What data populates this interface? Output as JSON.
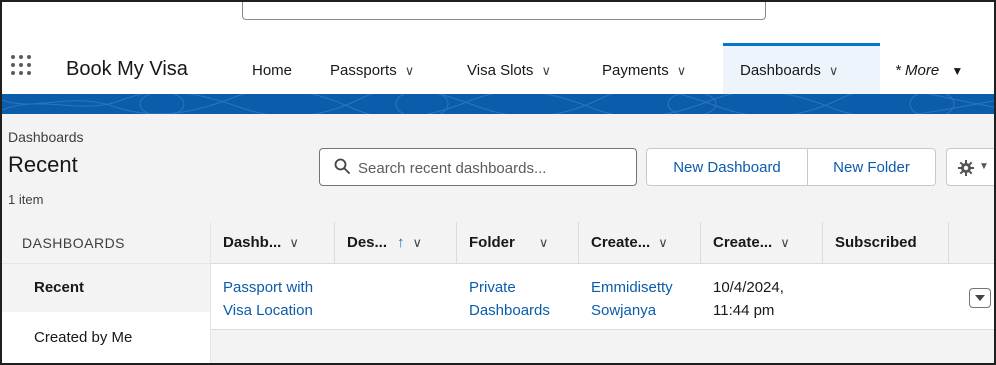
{
  "app": {
    "name": "Book My Visa"
  },
  "nav": {
    "items": [
      {
        "label": "Home"
      },
      {
        "label": "Passports"
      },
      {
        "label": "Visa Slots"
      },
      {
        "label": "Payments"
      },
      {
        "label": "Dashboards",
        "active": true
      }
    ],
    "more_star": "*",
    "more_label": "More"
  },
  "header": {
    "breadcrumb": "Dashboards",
    "title": "Recent",
    "count": "1 item"
  },
  "search": {
    "placeholder": "Search recent dashboards..."
  },
  "buttons": {
    "new_dashboard": "New Dashboard",
    "new_folder": "New Folder"
  },
  "sidebar": {
    "heading": "DASHBOARDS",
    "items": [
      {
        "label": "Recent",
        "active": true
      },
      {
        "label": "Created by Me"
      }
    ]
  },
  "table": {
    "columns": [
      "Dashb...",
      "Des...",
      "Folder",
      "Create...",
      "Create...",
      "Subscribed"
    ],
    "rows": [
      {
        "name_line1": "Passport with",
        "name_line2": "Visa Location",
        "description": "",
        "folder_line1": "Private",
        "folder_line2": "Dashboards",
        "created_by_line1": "Emmidisetty",
        "created_by_line2": "Sowjanya",
        "created_on_line1": "10/4/2024,",
        "created_on_line2": "11:44 pm",
        "subscribed": ""
      }
    ]
  },
  "colors": {
    "brand_band": "#0b5cab",
    "link": "#0b5cab",
    "active_tab_border": "#0176d3"
  },
  "icons": [
    "app-launcher-icon",
    "chevron-down-icon",
    "search-icon",
    "gear-icon",
    "sort-up-arrow-icon",
    "row-actions-icon"
  ]
}
